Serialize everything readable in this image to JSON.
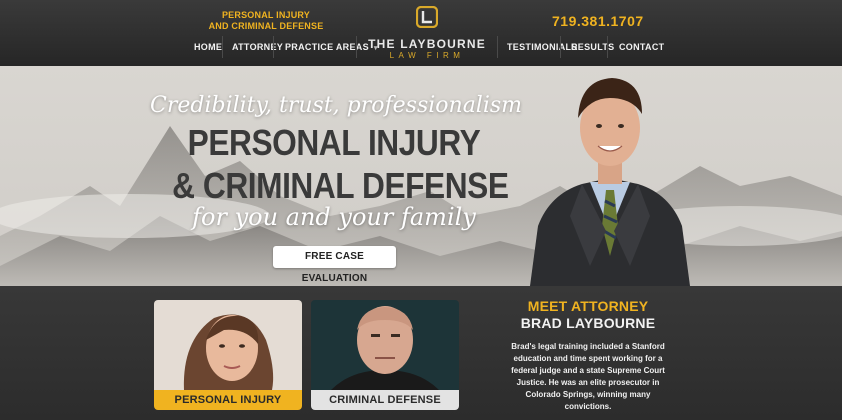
{
  "header": {
    "tagline_line1": "PERSONAL INJURY",
    "tagline_line2": "AND CRIMINAL DEFENSE",
    "phone": "719.381.1707",
    "logo_name": "THE LAYBOURNE",
    "logo_sub": "LAW FIRM"
  },
  "nav": {
    "home": "HOME",
    "attorney": "ATTORNEY",
    "practice_areas": "PRACTICE AREAS",
    "testimonials": "TESTIMONIALS",
    "results": "RESULTS",
    "contact": "CONTACT"
  },
  "hero": {
    "credibility": "Credibility, trust, professionalism",
    "headline1": "PERSONAL INJURY",
    "headline2": "& CRIMINAL DEFENSE",
    "for_you": "for you and your family",
    "cta": "FREE CASE EVALUATION"
  },
  "cards": {
    "personal_injury": "PERSONAL INJURY",
    "criminal_defense": "CRIMINAL DEFENSE"
  },
  "meet": {
    "title1": "MEET ATTORNEY",
    "title2": "BRAD LAYBOURNE",
    "bio_lines": [
      "Brad's legal training included a Stanford",
      "education and time spent working for a",
      "federal judge and a state Supreme Court",
      "Justice. He was an elite prosecutor in",
      "Colorado Springs, winning many",
      "convictions."
    ]
  },
  "colors": {
    "accent": "#f0b320",
    "header_bg": "#2f2f2f",
    "lower_bg": "#333333"
  },
  "icons": {
    "logo_mark": "firm-logo-icon",
    "caret": "chevron-down-icon"
  }
}
